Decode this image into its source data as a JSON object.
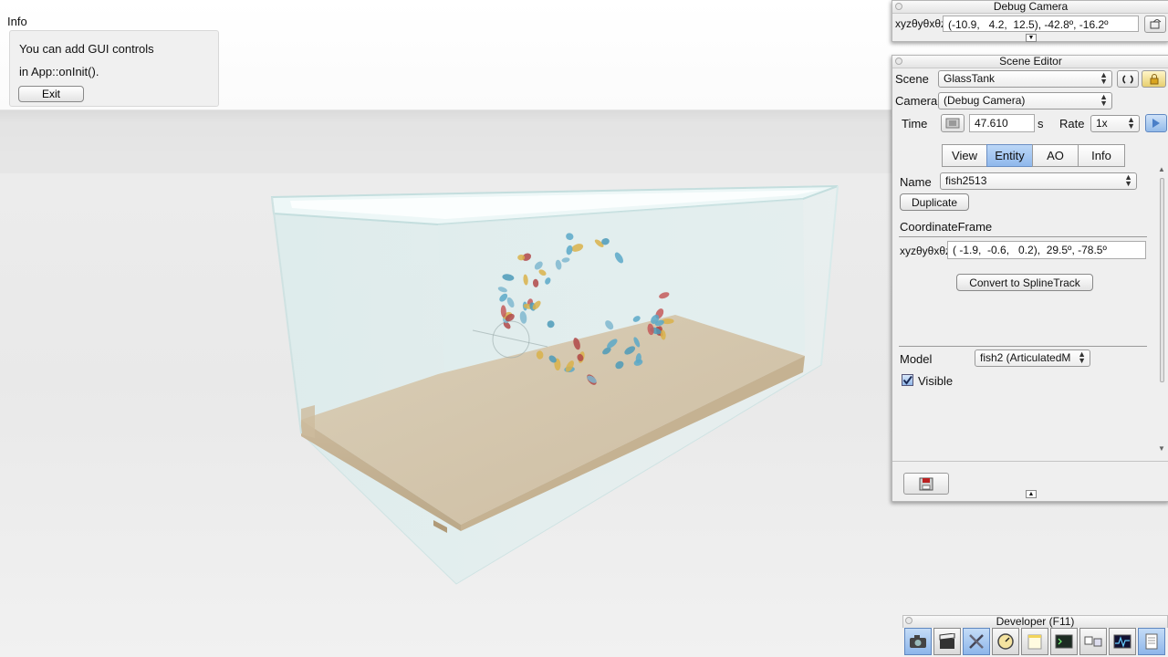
{
  "info": {
    "title": "Info",
    "line1": "You can add GUI controls",
    "line2": "in App::onInit().",
    "exit_label": "Exit"
  },
  "debug_camera": {
    "title": "Debug Camera",
    "label": "xyzθyθxθz",
    "value": "(-10.9,   4.2,  12.5), -42.8º, -16.2º"
  },
  "scene_editor": {
    "title": "Scene Editor",
    "scene_label": "Scene",
    "scene_value": "GlassTank",
    "camera_label": "Camera",
    "camera_value": "(Debug Camera)",
    "time_label": "Time",
    "time_value": "47.610",
    "time_unit": "s",
    "rate_label": "Rate",
    "rate_value": "1x",
    "tabs": [
      "View",
      "Entity",
      "AO",
      "Info"
    ],
    "active_tab": "Entity",
    "name_label": "Name",
    "name_value": "fish2513",
    "duplicate_label": "Duplicate",
    "frame_label": "CoordinateFrame",
    "frame_prefix": "xyzθyθxθz",
    "frame_value": "( -1.9,  -0.6,   0.2),  29.5º, -78.5º",
    "convert_label": "Convert to SplineTrack",
    "model_label": "Model",
    "model_value": "fish2 (ArticulatedM",
    "visible_label": "Visible",
    "visible_checked": true
  },
  "developer": {
    "title": "Developer (F11)",
    "tools": [
      "camera-icon",
      "film-clapper-icon",
      "tools-icon",
      "speedometer-icon",
      "note-icon",
      "terminal-icon",
      "scene-graph-icon",
      "profiler-icon",
      "document-icon"
    ]
  },
  "colors": {
    "accent": "#8fb8ec",
    "panel_bg": "#efefef",
    "sand": "#d5c4a8"
  }
}
